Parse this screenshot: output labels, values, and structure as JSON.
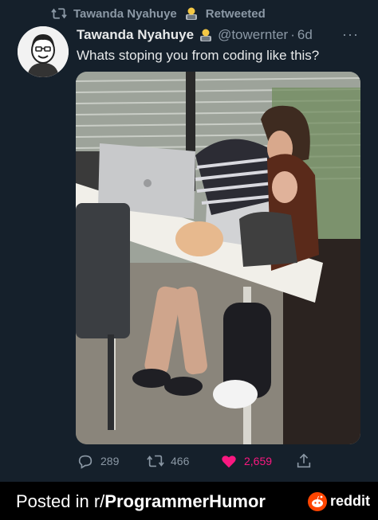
{
  "retweet": {
    "label": "Retweeted",
    "user": "Tawanda Nyahuye",
    "icon": "retweet-icon"
  },
  "tweet": {
    "author_name": "Tawanda Nyahuye",
    "handle": "@towernter",
    "separator": "·",
    "time": "6d",
    "more": "···",
    "text": "Whats stoping you from coding like this?"
  },
  "actions": {
    "replies": "289",
    "retweets": "466",
    "likes": "2,659",
    "like_color": "#f91880"
  },
  "footer": {
    "prefix": "Posted in r/",
    "subreddit": "ProgrammerHumor",
    "brand": "reddit",
    "brand_color": "#ff4500"
  },
  "colors": {
    "background": "#15202b",
    "muted": "#8b98a5",
    "text": "#e7e9ea"
  }
}
